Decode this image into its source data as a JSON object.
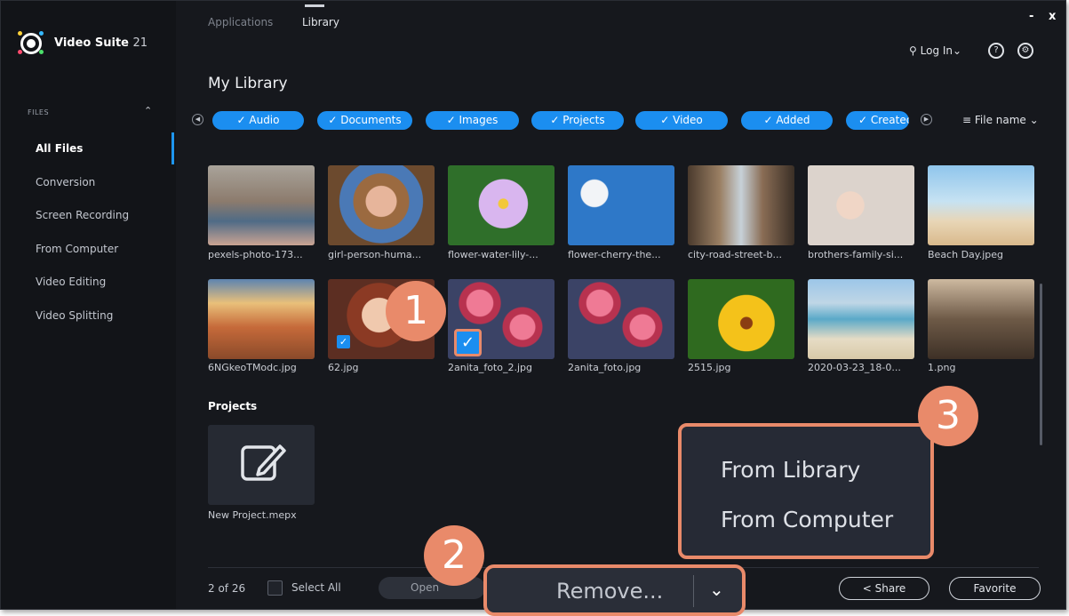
{
  "app": {
    "name": "Video Suite",
    "version": "21"
  },
  "top_tabs": [
    "Applications",
    "Library"
  ],
  "window_controls": {
    "minimize": "-",
    "close": "x"
  },
  "header": {
    "login_label": "Log In",
    "help_label": "?"
  },
  "sidebar": {
    "section": "FILES",
    "items": [
      "All Files",
      "Conversion",
      "Screen Recording",
      "From Computer",
      "Video Editing",
      "Video Splitting"
    ]
  },
  "library": {
    "title": "My Library",
    "filters": [
      "Audio",
      "Documents",
      "Images",
      "Projects",
      "Video",
      "Added",
      "Created"
    ],
    "sort_label": "File name",
    "files_row1": [
      "pexels-photo-173...",
      "girl-person-huma...",
      "flower-water-lily-...",
      "flower-cherry-the...",
      "city-road-street-b...",
      "brothers-family-si...",
      "Beach Day.jpeg"
    ],
    "files_row2": [
      "6NGkeoTModc.jpg",
      "62.jpg",
      "2anita_foto_2.jpg",
      "2anita_foto.jpg",
      "2515.jpg",
      "2020-03-23_18-0...",
      "1.png"
    ],
    "projects_label": "Projects",
    "project_name": "New Project.mepx"
  },
  "footer": {
    "count": "2 of 26",
    "select_all": "Select All",
    "open_label": "Open",
    "share_label": "Share",
    "favorite_label": "Favorite"
  },
  "remove_button": {
    "label": "Remove..."
  },
  "remove_menu": {
    "items": [
      "From Library",
      "From Computer"
    ]
  },
  "callouts": [
    "1",
    "2",
    "3"
  ],
  "colors": {
    "accent": "#1b8ef0",
    "callout": "#e98a6a",
    "background": "#16181d"
  }
}
